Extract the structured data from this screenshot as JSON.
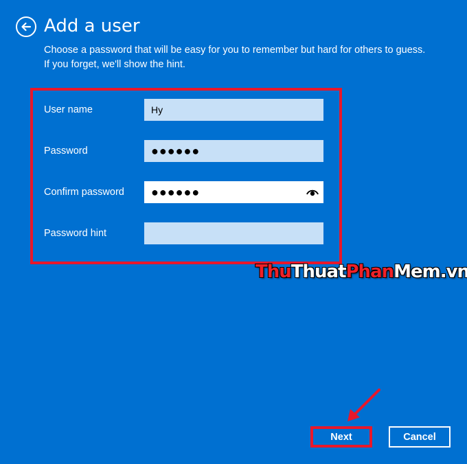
{
  "header": {
    "title": "Add a user",
    "back_icon": "back-arrow-icon"
  },
  "description": "Choose a password that will be easy for you to remember but hard for others to guess. If you forget, we'll show the hint.",
  "form": {
    "fields": [
      {
        "label": "User name",
        "value": "Hy",
        "placeholder": ""
      },
      {
        "label": "Password",
        "value": "●●●●●●",
        "placeholder": ""
      },
      {
        "label": "Confirm password",
        "value": "●●●●●●",
        "placeholder": ""
      },
      {
        "label": "Password hint",
        "value": "",
        "placeholder": ""
      }
    ],
    "reveal_icon": "eye-icon"
  },
  "watermark": {
    "part1": "Thu",
    "part2": "Thuat",
    "part3": "Phan",
    "part4": "Mem",
    "part5": ".vn"
  },
  "footer": {
    "next_label": "Next",
    "cancel_label": "Cancel"
  },
  "colors": {
    "background": "#0070d1",
    "field_bg": "#c7e0f7",
    "highlight": "#e8182b"
  }
}
